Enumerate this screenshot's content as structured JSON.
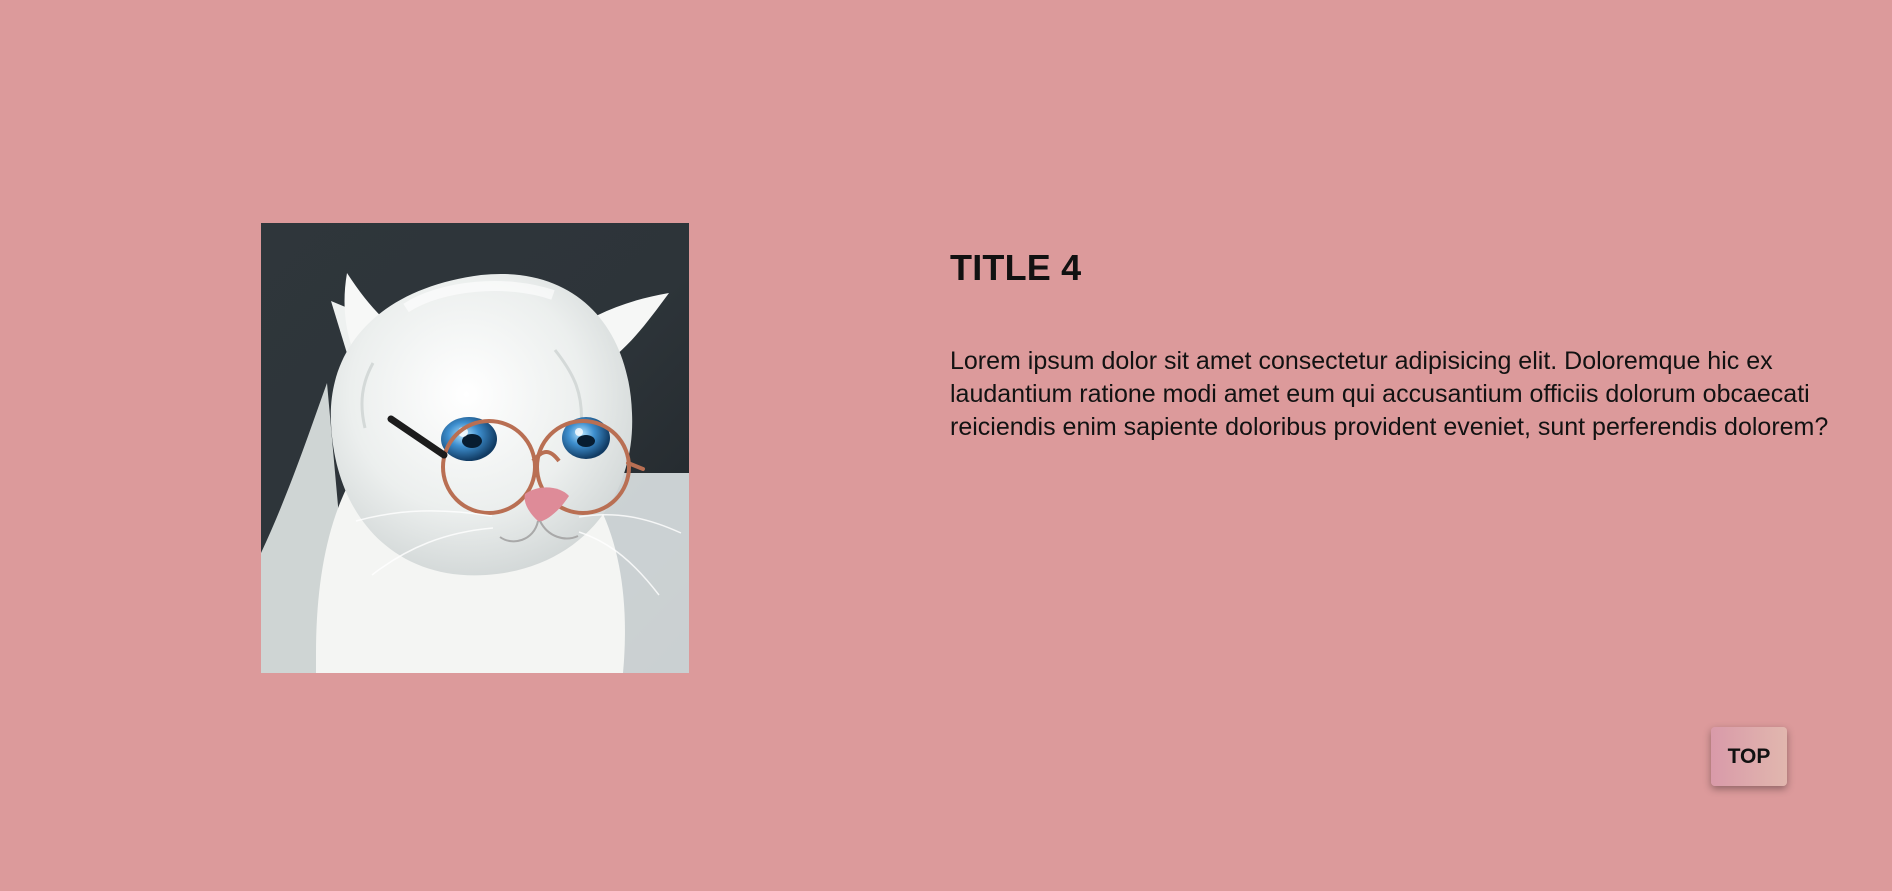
{
  "theme": {
    "background": "#dc9a9b",
    "button_gradient_start": "#d99aa9",
    "button_gradient_end": "#e1b7ae"
  },
  "hero": {
    "image_icon": "white-cat-with-glasses-image",
    "title": "TITLE 4",
    "body": "Lorem ipsum dolor sit amet consectetur adipisicing elit. Doloremque hic ex laudantium ratione modi amet eum qui accusantium officiis dolorum obcaecati reiciendis enim sapiente doloribus provident eveniet, sunt perferendis dolorem?"
  },
  "controls": {
    "top_label": "TOP"
  }
}
